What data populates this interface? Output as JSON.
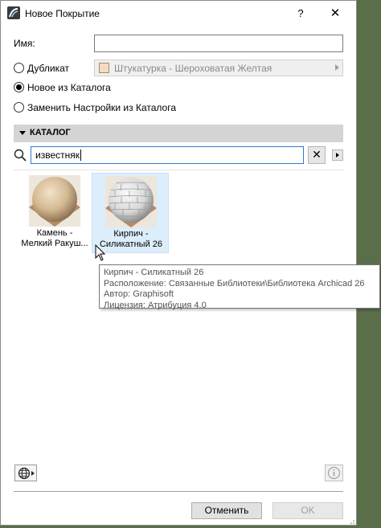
{
  "window": {
    "title": "Новое Покрытие",
    "help_label": "?",
    "close_label": "✕"
  },
  "name_field": {
    "label": "Имя:",
    "value": ""
  },
  "options": {
    "duplicate_label": "Дубликат",
    "duplicate_value": "Штукатурка - Шероховатая Желтая",
    "new_from_catalog_label": "Новое из Каталога",
    "replace_label": "Заменить Настройки из Каталога",
    "selected": "new_from_catalog"
  },
  "catalog": {
    "header": "КАТАЛОГ",
    "search_value": "известняк",
    "clear_label": "✕",
    "items": [
      {
        "label_line1": "Камень -",
        "label_line2": "Мелкий Ракуш...",
        "selected": false
      },
      {
        "label_line1": "Кирпич -",
        "label_line2": "Силикатный 26",
        "selected": true
      }
    ]
  },
  "tooltip": {
    "line1": "Кирпич - Силикатный 26",
    "line2": "Расположение: Связанные Библиотеки\\Библиотека Archicad 26",
    "line3": "Автор: Graphisoft",
    "line4": "Лицензия: Атрибуция 4.0"
  },
  "buttons": {
    "cancel": "Отменить",
    "ok": "OK"
  },
  "colors": {
    "accent": "#2d7bd2",
    "selection": "#dceefb",
    "section_bg": "#d4d4d4"
  }
}
